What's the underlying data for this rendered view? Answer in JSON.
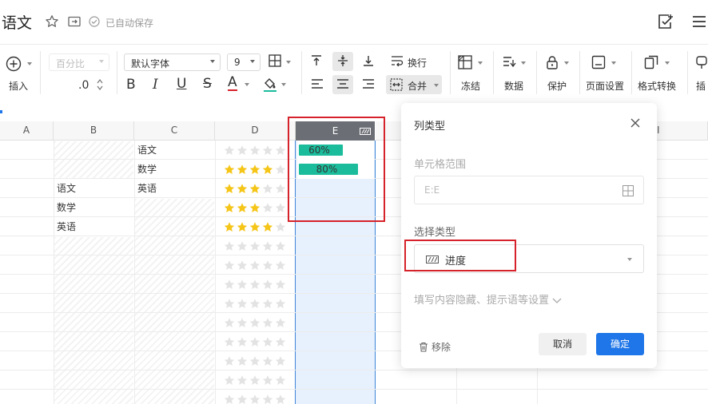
{
  "titlebar": {
    "title": "语文",
    "saved_text": "已自动保存"
  },
  "toolbar": {
    "insert_label": "插入",
    "number_format": "百分比",
    "decimal": ".0",
    "font_family": "默认字体",
    "font_size": "9",
    "wrap_label": "换行",
    "merge_label": "合并",
    "freeze_label": "冻结",
    "data_label": "数据",
    "protect_label": "保护",
    "page_setup_label": "页面设置",
    "format_convert_label": "格式转换",
    "insert_chart_label": "插"
  },
  "sheet": {
    "columns": [
      "A",
      "B",
      "C",
      "D",
      "E",
      "I"
    ],
    "rows": [
      {
        "b": "",
        "c": "语文",
        "stars": 0,
        "progress": "60%",
        "progress_fraction": 0.6
      },
      {
        "b": "",
        "c": "数学",
        "stars": 4,
        "progress": "80%",
        "progress_fraction": 0.8
      },
      {
        "b": "语文",
        "c": "英语",
        "stars": 3,
        "progress": "",
        "progress_fraction": 0
      },
      {
        "b": "数学",
        "c": "",
        "stars": 3,
        "progress": "",
        "progress_fraction": 0
      },
      {
        "b": "英语",
        "c": "",
        "stars": 4,
        "progress": "",
        "progress_fraction": 0
      }
    ],
    "star_color": "#f5c518",
    "progress_color": "#1abc9c"
  },
  "dialog": {
    "title": "列类型",
    "range_label": "单元格范围",
    "range_placeholder": "E:E",
    "type_label": "选择类型",
    "type_value": "进度",
    "expand_text": "填写内容隐藏、提示语等设置",
    "remove_label": "移除",
    "cancel_label": "取消",
    "ok_label": "确定",
    "ok_color": "#1f76e8"
  }
}
